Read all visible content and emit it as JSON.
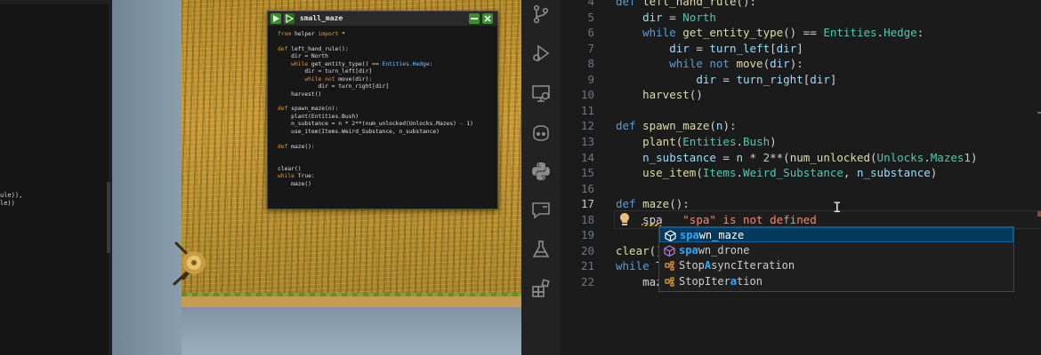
{
  "left_panel": {
    "code_lines": [
      "ule)),",
      "le))"
    ]
  },
  "game_window": {
    "title": "small_maze",
    "code_lines": [
      {
        "parts": [
          [
            "k",
            "from "
          ],
          [
            "",
            "helper "
          ],
          [
            "k",
            "import "
          ],
          [
            "",
            "*"
          ]
        ]
      },
      {
        "parts": [
          [
            "",
            ""
          ]
        ]
      },
      {
        "parts": [
          [
            "k",
            "def "
          ],
          [
            "",
            "left_hand_rule():"
          ]
        ]
      },
      {
        "parts": [
          [
            "",
            "    dir = North"
          ]
        ]
      },
      {
        "parts": [
          [
            "k",
            "    while "
          ],
          [
            "",
            "get_entity_type() == "
          ],
          [
            "t",
            "Entities.Hedge"
          ],
          [
            "",
            ":"
          ]
        ]
      },
      {
        "parts": [
          [
            "",
            "        dir = turn_left[dir]"
          ]
        ]
      },
      {
        "parts": [
          [
            "k",
            "        while not "
          ],
          [
            "",
            "move(dir):"
          ]
        ]
      },
      {
        "parts": [
          [
            "",
            "            dir = turn_right[dir]"
          ]
        ]
      },
      {
        "parts": [
          [
            "",
            "    harvest()"
          ]
        ]
      },
      {
        "parts": [
          [
            "",
            ""
          ]
        ]
      },
      {
        "parts": [
          [
            "k",
            "def "
          ],
          [
            "",
            "spawn_maze(n):"
          ]
        ]
      },
      {
        "parts": [
          [
            "",
            "    plant(Entities.Bush)"
          ]
        ]
      },
      {
        "parts": [
          [
            "",
            "    n_substance = n * 2**(num_unlocked(Unlocks.Mazes) - 1)"
          ]
        ]
      },
      {
        "parts": [
          [
            "",
            "    use_item(Items.Weird_Substance, n_substance)"
          ]
        ]
      },
      {
        "parts": [
          [
            "",
            ""
          ]
        ]
      },
      {
        "parts": [
          [
            "k",
            "def "
          ],
          [
            "",
            "maze():"
          ]
        ]
      },
      {
        "parts": [
          [
            "",
            ""
          ]
        ]
      },
      {
        "parts": [
          [
            "",
            ""
          ]
        ]
      },
      {
        "parts": [
          [
            "",
            "clear()"
          ]
        ]
      },
      {
        "parts": [
          [
            "k",
            "while "
          ],
          [
            "",
            "True:"
          ]
        ]
      },
      {
        "parts": [
          [
            "",
            "    maze()"
          ]
        ]
      }
    ]
  },
  "activity_bar": {
    "icons": [
      "source-control-icon",
      "run-debug-icon",
      "remote-explorer-icon",
      "copilot-icon",
      "python-icon",
      "comments-icon",
      "testing-icon",
      "extensions-icon"
    ]
  },
  "editor": {
    "lines": [
      {
        "n": "4",
        "parts": [
          [
            "kw",
            "def "
          ],
          [
            "fn",
            "left_hand_rule"
          ],
          [
            "",
            "():"
          ]
        ]
      },
      {
        "n": "5",
        "parts": [
          [
            "",
            "    "
          ],
          [
            "var",
            "dir"
          ],
          [
            "",
            " = "
          ],
          [
            "cls",
            "North"
          ]
        ]
      },
      {
        "n": "6",
        "parts": [
          [
            "",
            "    "
          ],
          [
            "kw",
            "while "
          ],
          [
            "fn",
            "get_entity_type"
          ],
          [
            "",
            "() == "
          ],
          [
            "cls",
            "Entities"
          ],
          [
            "",
            "."
          ],
          [
            "cls",
            "Hedge"
          ],
          [
            "",
            ":"
          ]
        ]
      },
      {
        "n": "7",
        "parts": [
          [
            "",
            "        "
          ],
          [
            "var",
            "dir"
          ],
          [
            "",
            " = "
          ],
          [
            "var",
            "turn_left"
          ],
          [
            "",
            "["
          ],
          [
            "var",
            "dir"
          ],
          [
            "",
            "]"
          ]
        ]
      },
      {
        "n": "8",
        "parts": [
          [
            "",
            "        "
          ],
          [
            "kw",
            "while not "
          ],
          [
            "fn",
            "move"
          ],
          [
            "",
            "("
          ],
          [
            "var",
            "dir"
          ],
          [
            "",
            "):"
          ]
        ]
      },
      {
        "n": "9",
        "parts": [
          [
            "",
            "            "
          ],
          [
            "var",
            "dir"
          ],
          [
            "",
            " = "
          ],
          [
            "var",
            "turn_right"
          ],
          [
            "",
            "["
          ],
          [
            "var",
            "dir"
          ],
          [
            "",
            "]"
          ]
        ]
      },
      {
        "n": "10",
        "parts": [
          [
            "",
            "    "
          ],
          [
            "fn",
            "harvest"
          ],
          [
            "",
            "()"
          ]
        ]
      },
      {
        "n": "11",
        "parts": [
          [
            "",
            ""
          ]
        ]
      },
      {
        "n": "12",
        "parts": [
          [
            "kw",
            "def "
          ],
          [
            "fn",
            "spawn_maze"
          ],
          [
            "",
            "("
          ],
          [
            "var",
            "n"
          ],
          [
            "",
            "):"
          ]
        ]
      },
      {
        "n": "13",
        "parts": [
          [
            "",
            "    "
          ],
          [
            "fn",
            "plant"
          ],
          [
            "",
            "("
          ],
          [
            "cls",
            "Entities"
          ],
          [
            "",
            "."
          ],
          [
            "cls",
            "Bush"
          ],
          [
            "",
            ")"
          ]
        ]
      },
      {
        "n": "14",
        "parts": [
          [
            "",
            "    "
          ],
          [
            "var",
            "n_substance"
          ],
          [
            "",
            " = "
          ],
          [
            "var",
            "n"
          ],
          [
            "",
            " * "
          ],
          [
            "num",
            "2"
          ],
          [
            "",
            "**("
          ],
          [
            "fn",
            "num_unlocked"
          ],
          [
            "",
            "("
          ],
          [
            "cls",
            "Unlocks"
          ],
          [
            "",
            "."
          ],
          [
            "cls",
            "Mazes"
          ],
          [
            ") - ",
            ""
          ],
          [
            "num",
            "1"
          ],
          [
            "",
            ")"
          ]
        ]
      },
      {
        "n": "15",
        "parts": [
          [
            "",
            "    "
          ],
          [
            "fn",
            "use_item"
          ],
          [
            "",
            "("
          ],
          [
            "cls",
            "Items"
          ],
          [
            "",
            "."
          ],
          [
            "cls",
            "Weird_Substance"
          ],
          [
            "",
            ", "
          ],
          [
            "var",
            "n_substance"
          ],
          [
            "",
            ")"
          ]
        ]
      },
      {
        "n": "16",
        "parts": [
          [
            "",
            ""
          ]
        ]
      },
      {
        "n": "17",
        "parts": [
          [
            "kw",
            "def "
          ],
          [
            "fn",
            "maze"
          ],
          [
            "",
            "():"
          ]
        ]
      },
      {
        "n": "18",
        "parts": [
          [
            "",
            "    spa   "
          ],
          [
            "err-msg",
            "\"spa\" is not defined"
          ]
        ]
      },
      {
        "n": "19",
        "parts": [
          [
            "",
            ""
          ]
        ]
      },
      {
        "n": "20",
        "parts": [
          [
            "fn",
            "clear"
          ],
          [
            "",
            "()"
          ]
        ]
      },
      {
        "n": "21",
        "parts": [
          [
            "kw",
            "while "
          ],
          [
            "",
            "T"
          ]
        ]
      },
      {
        "n": "22",
        "parts": [
          [
            "",
            "    maz"
          ]
        ]
      }
    ],
    "active_line": "17"
  },
  "suggest": {
    "items": [
      {
        "kind": "function",
        "hl": "spa",
        "rest": "wn_maze"
      },
      {
        "kind": "function",
        "hl": "spa",
        "rest": "wn_drone"
      },
      {
        "kind": "class",
        "pre": "Stop",
        "hl": "A",
        "rest": "syncIteration"
      },
      {
        "kind": "class",
        "pre": "StopIter",
        "hl": "a",
        "rest": "tion"
      }
    ]
  }
}
